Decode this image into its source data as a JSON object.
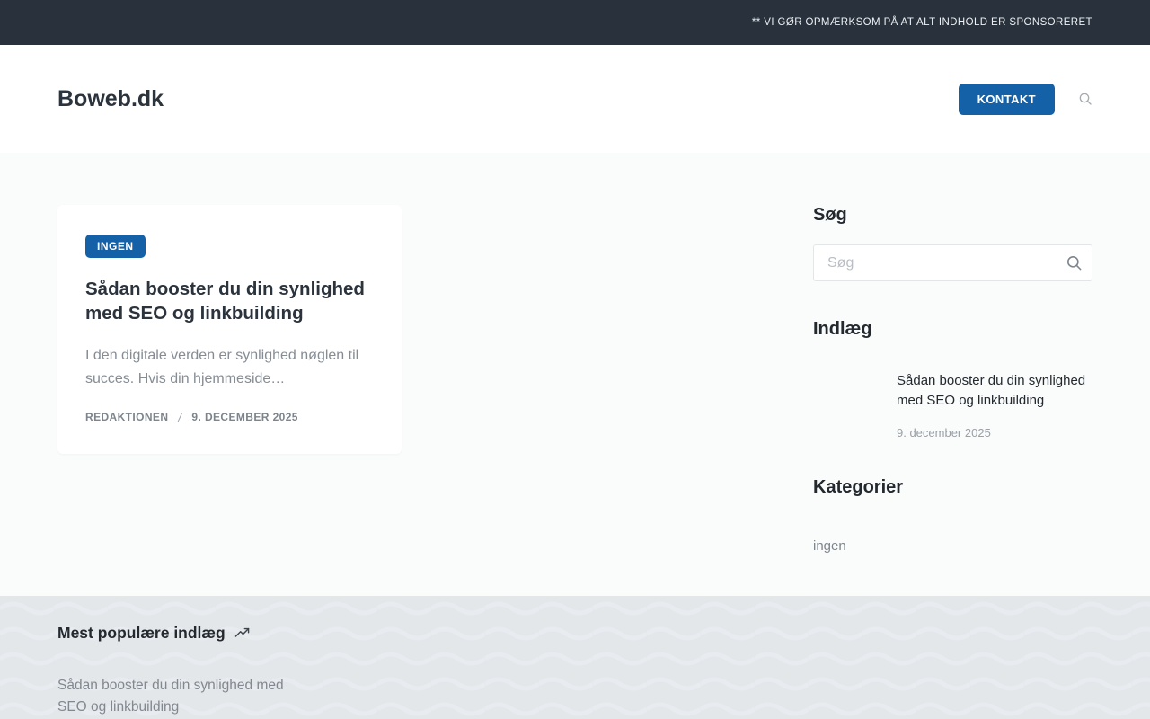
{
  "topbar": {
    "notice": "** VI GØR OPMÆRKSOM PÅ AT ALT INDHOLD ER SPONSORERET"
  },
  "header": {
    "site_title": "Boweb.dk",
    "kontakt_label": "KONTAKT"
  },
  "main": {
    "post_card": {
      "badge": "INGEN",
      "title": "Sådan booster du din synlighed med SEO og linkbuilding",
      "excerpt": "I den digitale verden er synlighed nøglen til succes. Hvis din hjemmeside…",
      "author": "REDAKTIONEN",
      "meta_separator": "/",
      "date": "9. DECEMBER 2025"
    },
    "sidebar": {
      "search": {
        "heading": "Søg",
        "placeholder": "Søg"
      },
      "posts": {
        "heading": "Indlæg",
        "items": [
          {
            "title": "Sådan booster du din synlighed med SEO og linkbuilding",
            "date": "9. december 2025"
          }
        ]
      },
      "categories": {
        "heading": "Kategorier",
        "items": [
          {
            "label": "ingen"
          }
        ]
      }
    }
  },
  "footer": {
    "popular": {
      "heading": "Mest populære indlæg",
      "items": [
        {
          "title": "Sådan booster du din synlighed med SEO og linkbuilding"
        }
      ]
    }
  },
  "colors": {
    "accent_blue": "#1561a8",
    "topbar_bg": "#28313c",
    "page_bg": "#fafbfb",
    "footer_bg": "#e3e7ea"
  }
}
